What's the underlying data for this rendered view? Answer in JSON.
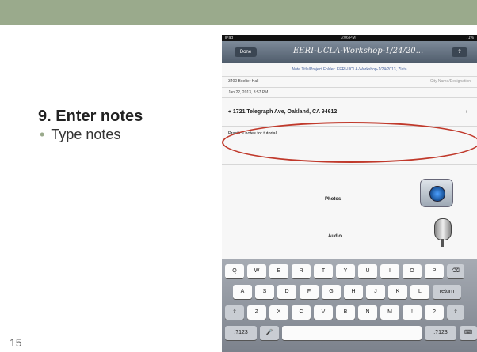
{
  "slide": {
    "heading": "9. Enter notes",
    "bullet": "Type notes",
    "page_number": "15"
  },
  "ipad": {
    "status": {
      "left": "iPad",
      "time": "3:06 PM",
      "battery": "71%"
    },
    "nav": {
      "back_label": "Done",
      "title": "EERI-UCLA-Workshop-1/24/20...",
      "share_icon": "share-icon"
    },
    "folder_line": "Note Title/Project Folder: EERI-UCLA-Workshop-1/24/2013, Zlata",
    "location_left": "3400 Boelter Hall",
    "location_right": "City Name/Designation",
    "date_line": "Jan 22, 2013, 3:57 PM",
    "address": "1721 Telegraph Ave, Oakland, CA 94612",
    "notes_text": "Practice notes for tutorial",
    "photos_label": "Photos",
    "audio_label": "Audio"
  },
  "keyboard": {
    "row1": [
      "Q",
      "W",
      "E",
      "R",
      "T",
      "Y",
      "U",
      "I",
      "O",
      "P",
      "⌫"
    ],
    "row2": [
      "A",
      "S",
      "D",
      "F",
      "G",
      "H",
      "J",
      "K",
      "L",
      "return"
    ],
    "row3": [
      "⇧",
      "Z",
      "X",
      "C",
      "V",
      "B",
      "N",
      "M",
      "!",
      "?",
      "⇧"
    ],
    "row4": [
      ".?123",
      "🎤",
      "",
      ".?123",
      "⌨"
    ]
  },
  "colors": {
    "accent_bar": "#9aaa8c",
    "highlight": "#c0392b"
  }
}
